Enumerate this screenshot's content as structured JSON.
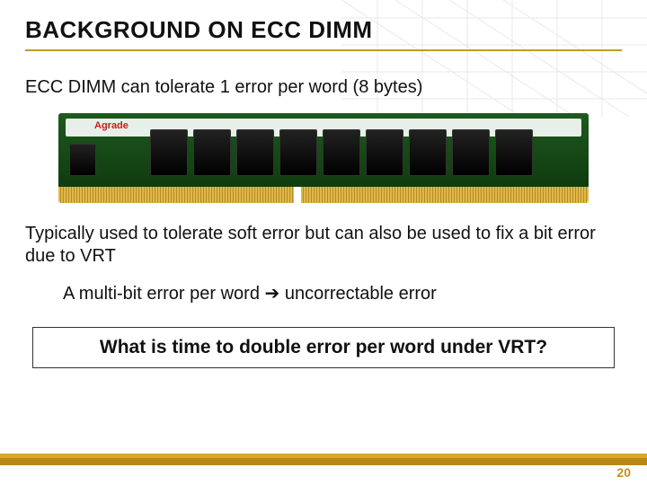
{
  "title": "BACKGROUND ON ECC DIMM",
  "para1": "ECC DIMM can tolerate 1 error per word (8 bytes)",
  "dimm": {
    "brand": "Agrade"
  },
  "para2": "Typically used to tolerate soft error but can also be used to fix a bit error due to VRT",
  "indent_prefix": "A multi-bit error per word ",
  "arrow": "➔",
  "indent_suffix": " uncorrectable error",
  "callout": "What is time to double error per word under VRT?",
  "page_number": "20"
}
